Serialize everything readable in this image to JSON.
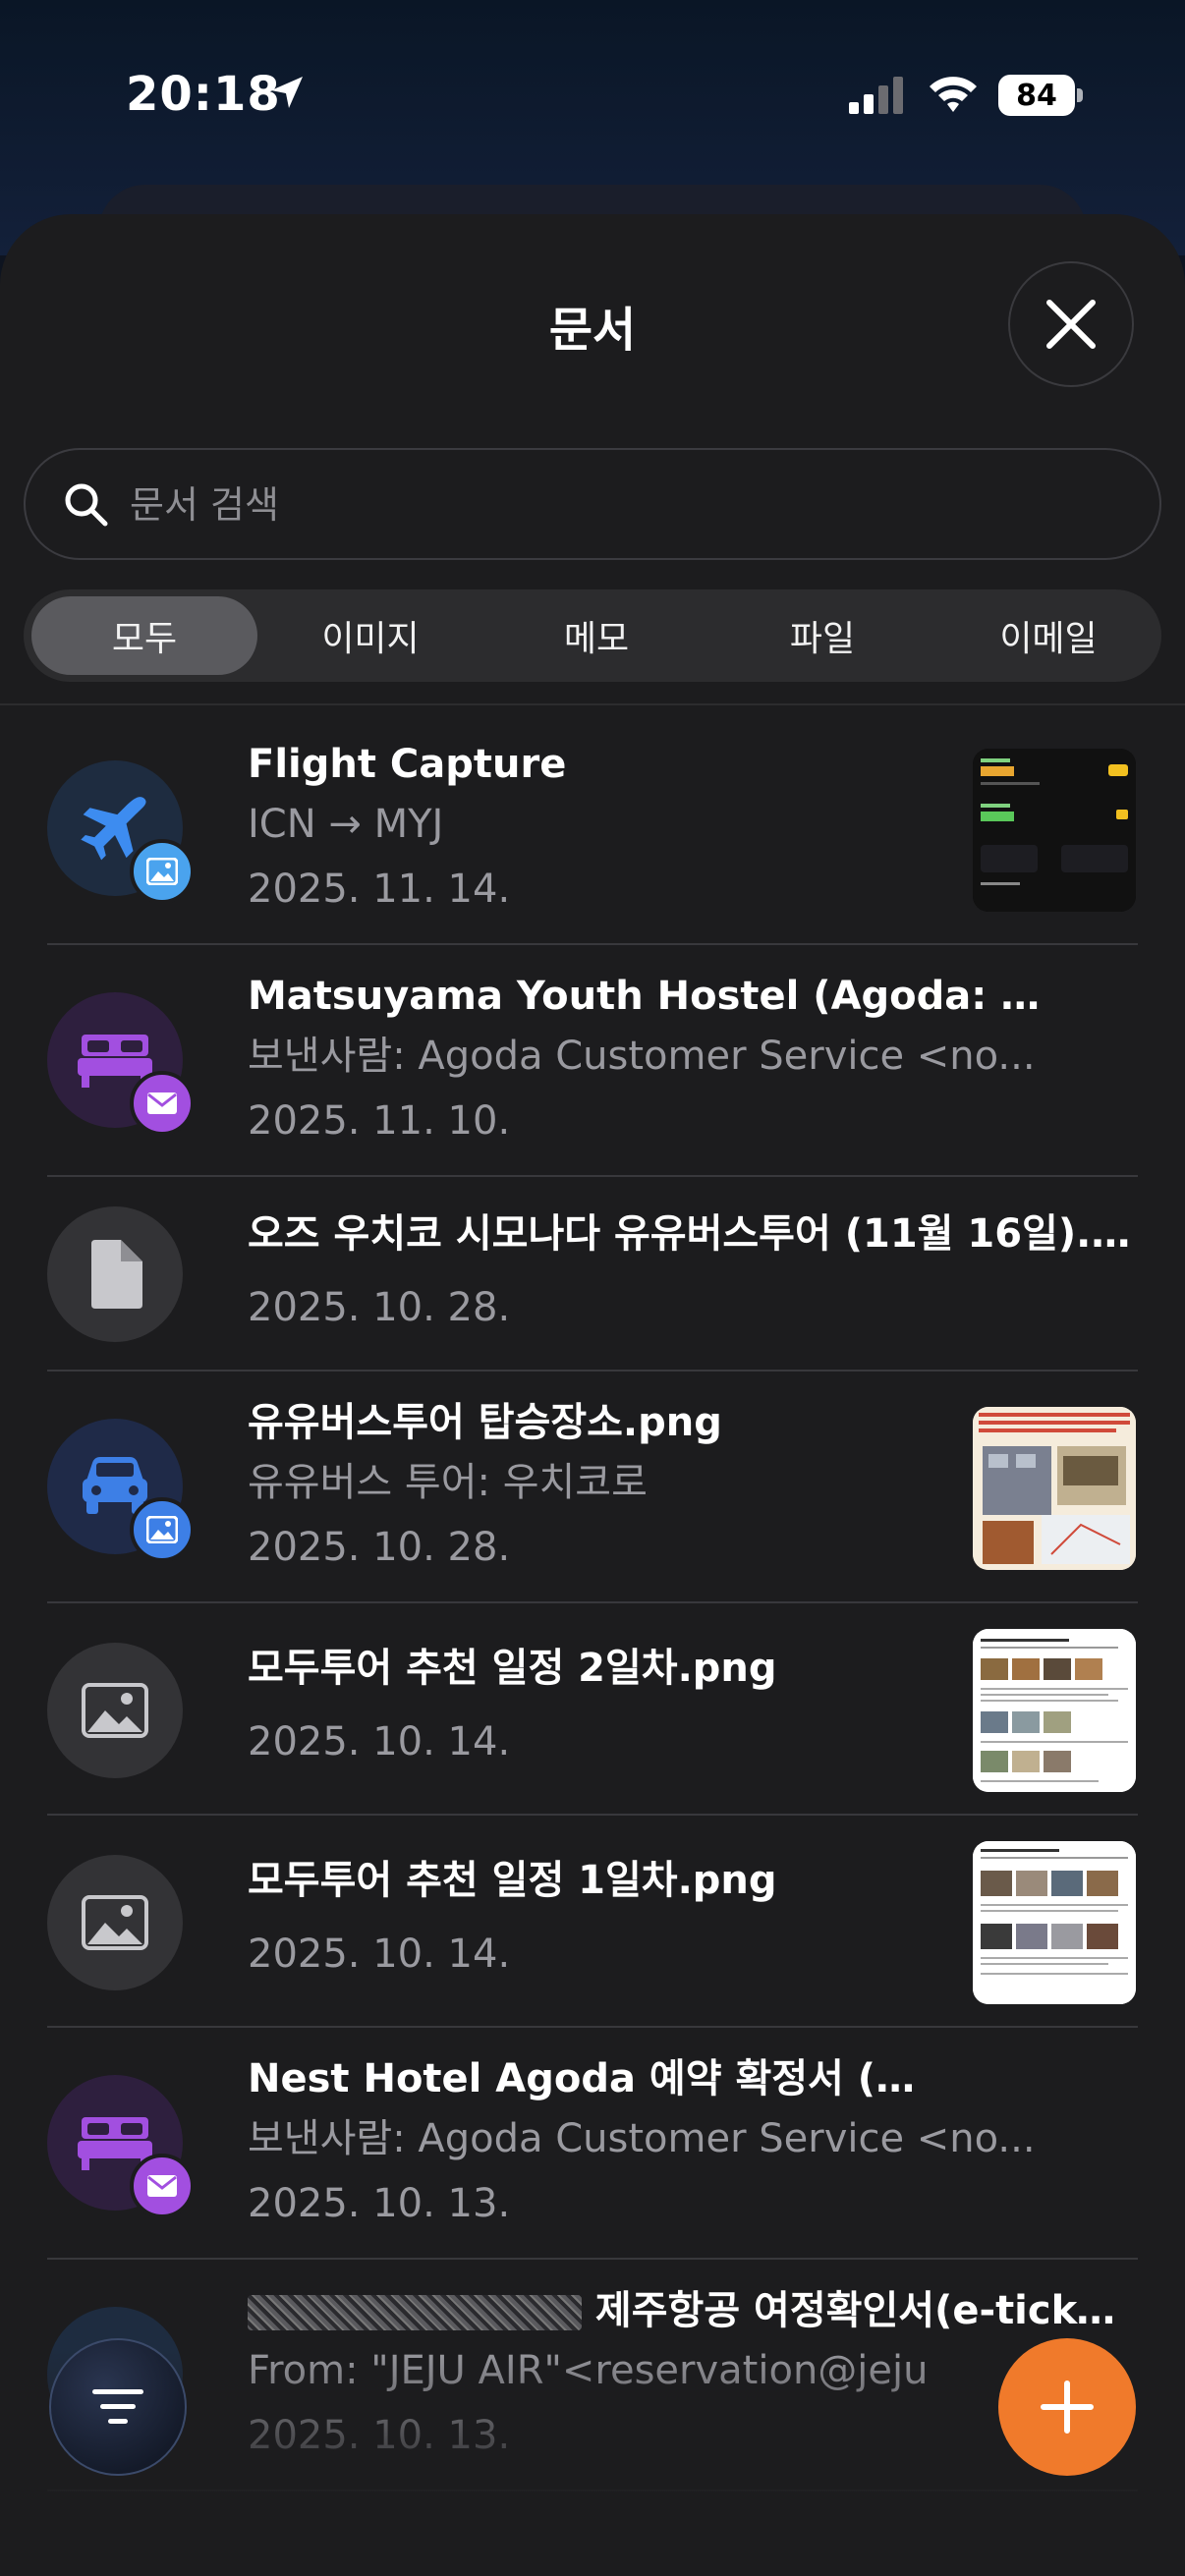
{
  "status_bar": {
    "time": "20:18",
    "battery": "84"
  },
  "sheet": {
    "title": "문서"
  },
  "search": {
    "placeholder": "문서 검색",
    "value": ""
  },
  "tabs": [
    "모두",
    "이미지",
    "메모",
    "파일",
    "이메일"
  ],
  "active_tab": "모두",
  "documents": [
    {
      "title": "Flight Capture",
      "subtitle": "ICN → MYJ",
      "date": "2025. 11. 14.",
      "icon": "airplane-icon",
      "badge": "image-icon"
    },
    {
      "title": "Matsuyama Youth Hostel (Agoda: ",
      "title_tail": "...",
      "subtitle": "보낸사람: Agoda Customer Service <no...",
      "date": "2025. 11. 10.",
      "icon": "bed-icon",
      "badge": "mail-icon"
    },
    {
      "title": "오즈 우치코 시모나다 유유버스투어 (11월 16일).p...",
      "date": "2025. 10. 28.",
      "icon": "file-icon"
    },
    {
      "title": "유유버스투어 탑승장소.png",
      "subtitle": "유유버스 투어: 우치코로",
      "date": "2025. 10. 28.",
      "icon": "car-icon",
      "badge": "image-icon"
    },
    {
      "title": "모두투어 추천 일정 2일차.png",
      "date": "2025. 10. 14.",
      "icon": "image-icon"
    },
    {
      "title": "모두투어 추천 일정 1일차.png",
      "date": "2025. 10. 14.",
      "icon": "image-icon"
    },
    {
      "title": "Nest Hotel Agoda 예약 확정서 (",
      "title_tail": ")",
      "subtitle": "보낸사람: Agoda Customer Service <no...",
      "date": "2025. 10. 13.",
      "icon": "bed-icon",
      "badge": "mail-icon"
    },
    {
      "title": " 제주항공 여정확인서(e-ticket)",
      "subtitle": "From: \"JEJU AIR\"<reservation@jeju",
      "date": "2025. 10. 13."
    }
  ],
  "colors": {
    "accent_orange": "#f07a2b",
    "purple": "#a24fe0",
    "blue": "#3d7fe6",
    "sheet_bg": "#1c1c1e"
  }
}
